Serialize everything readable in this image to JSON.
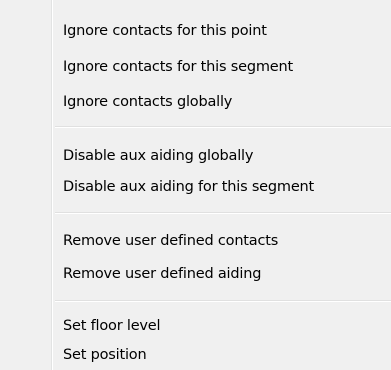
{
  "menu": {
    "groups": [
      {
        "items": [
          {
            "label": "Ignore contacts for this point"
          },
          {
            "label": "Ignore contacts for this segment"
          },
          {
            "label": "Ignore contacts globally"
          }
        ]
      },
      {
        "items": [
          {
            "label": "Disable aux aiding globally"
          },
          {
            "label": "Disable aux aiding for this segment"
          }
        ]
      },
      {
        "items": [
          {
            "label": "Remove user defined contacts"
          },
          {
            "label": "Remove user defined aiding"
          }
        ]
      },
      {
        "items": [
          {
            "label": "Set floor level"
          },
          {
            "label": "Set position"
          }
        ]
      }
    ]
  }
}
